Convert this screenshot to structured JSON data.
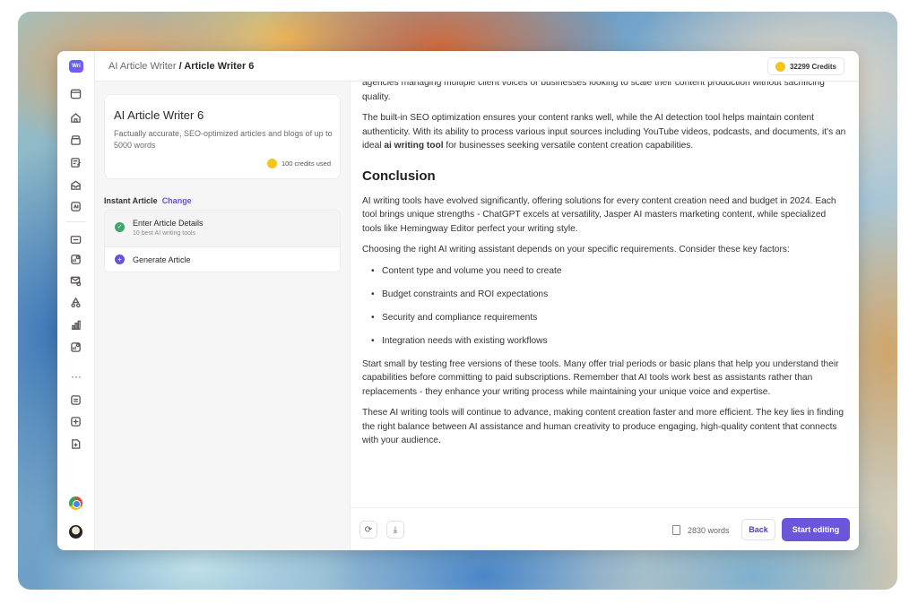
{
  "app": {
    "logo_text": "Wri",
    "breadcrumb_parent": "AI Article Writer",
    "breadcrumb_separator": " / ",
    "breadcrumb_current": "Article Writer 6",
    "credits_label": "32299 Credits"
  },
  "rail_icons": [
    "calendar-icon",
    "home-icon",
    "box-icon",
    "edit-icon",
    "inbox-icon",
    "ai-icon",
    "seo-icon",
    "chart-pie-icon",
    "mail-search-icon",
    "recycle-icon",
    "bar-chart-icon",
    "ai-chip-icon",
    "more-icon",
    "rss-icon",
    "grid-icon",
    "document-icon"
  ],
  "tool_card": {
    "title": "AI Article Writer 6",
    "description": "Factually accurate, SEO-optimized articles and blogs of up to 5000 words",
    "credits_used": "100 credits used"
  },
  "mode": {
    "label": "Instant Article",
    "change_label": "Change"
  },
  "steps": [
    {
      "label": "Enter Article Details",
      "sub": "10 best AI writing tools",
      "status": "done",
      "icon": "✓"
    },
    {
      "label": "Generate Article",
      "status": "pending",
      "icon": "+"
    }
  ],
  "article": {
    "p_intro_tail": "agencies managing multiple client voices or businesses looking to scale their content production without sacrificing quality.",
    "p_seo_before": "The built-in SEO optimization ensures your content ranks well, while the AI detection tool helps maintain content authenticity. With its ability to process various input sources including YouTube videos, podcasts, and documents, it's an ideal ",
    "p_seo_bold": "ai writing tool",
    "p_seo_after": " for businesses seeking versatile content creation capabilities.",
    "heading": "Conclusion",
    "p_conclusion": "AI writing tools have evolved significantly, offering solutions for every content creation need and budget in 2024. Each tool brings unique strengths - ChatGPT excels at versatility, Jasper AI masters marketing content, while specialized tools like Hemingway Editor perfect your writing style.",
    "p_choose": "Choosing the right AI writing assistant depends on your specific requirements. Consider these key factors:",
    "factors": [
      "Content type and volume you need to create",
      "Budget constraints and ROI expectations",
      "Security and compliance requirements",
      "Integration needs with existing workflows"
    ],
    "p_start": "Start small by testing free versions of these tools. Many offer trial periods or basic plans that help you understand their capabilities before committing to paid subscriptions. Remember that AI tools work best as assistants rather than replacements - they enhance your writing process while maintaining your unique voice and expertise.",
    "p_final": "These AI writing tools will continue to advance, making content creation faster and more efficient. The key lies in finding the right balance between AI assistance and human creativity to produce engaging, high-quality content that connects with your audience."
  },
  "footer": {
    "refresh_icon": "⟳",
    "download_icon": "⤓",
    "word_count": "2830 words",
    "back_label": "Back",
    "start_label": "Start editing"
  },
  "colors": {
    "accent": "#6b55d8",
    "success": "#3fa56d",
    "coin": "#f5c518"
  }
}
